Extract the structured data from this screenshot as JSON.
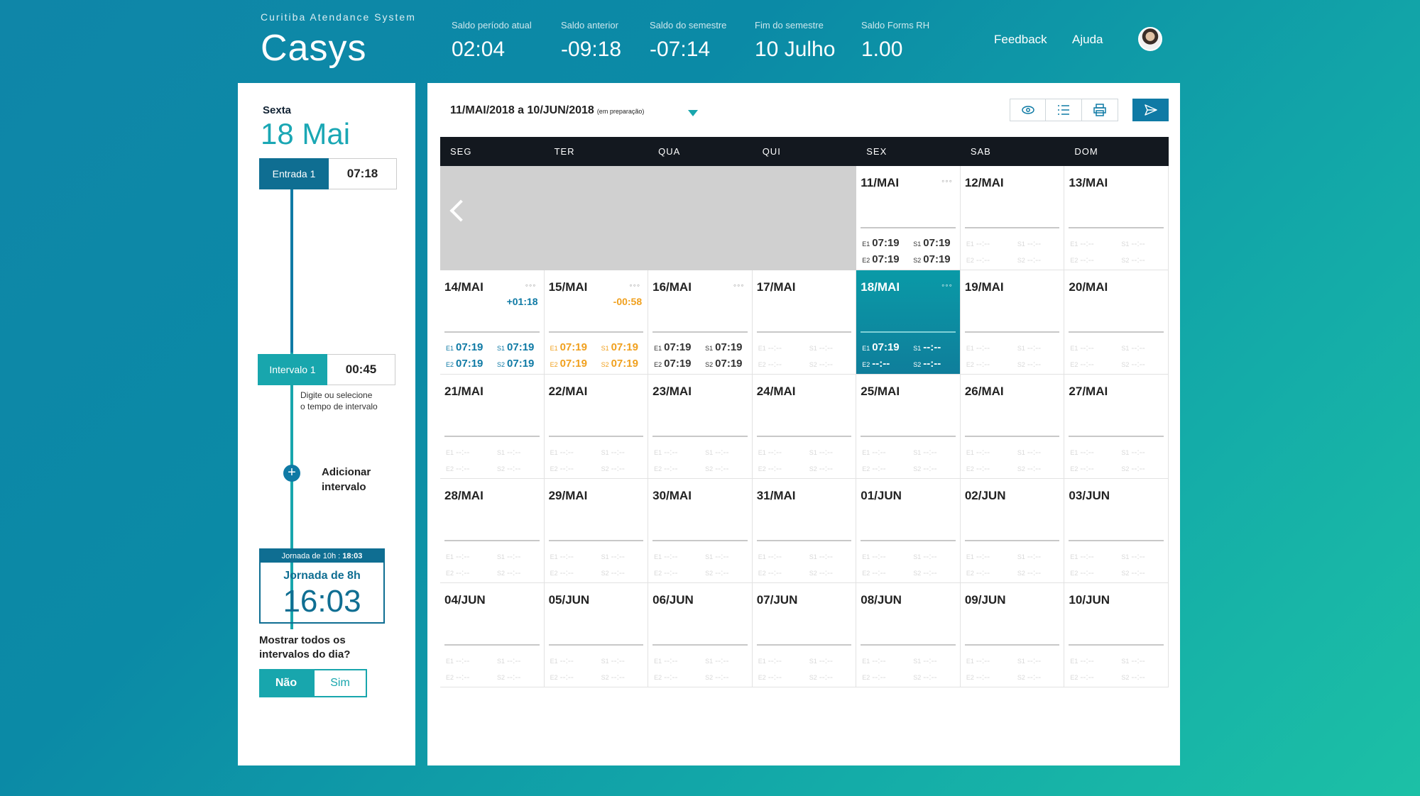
{
  "brand": {
    "subtitle": "Curitiba Atendance System",
    "name": "Casys"
  },
  "stats": [
    {
      "label": "Saldo período atual",
      "value": "02:04"
    },
    {
      "label": "Saldo anterior",
      "value": "-09:18"
    },
    {
      "label": "Saldo do semestre",
      "value": "-07:14"
    },
    {
      "label": "Fim do semestre",
      "value": "10 Julho"
    },
    {
      "label": "Saldo Forms RH",
      "value": "1.00"
    }
  ],
  "nav": {
    "feedback": "Feedback",
    "help": "Ajuda"
  },
  "left": {
    "day_name": "Sexta",
    "day_date": "18 Mai",
    "entry": {
      "tag": "Entrada 1",
      "time": "07:18"
    },
    "interval": {
      "tag": "Intervalo 1",
      "time": "00:45"
    },
    "hint_line1": "Digite ou selecione",
    "hint_line2": "o tempo de intervalo",
    "add_line1": "Adicionar",
    "add_line2": "intervalo",
    "jornada_bar_label": "Jornada de 10h :",
    "jornada_bar_time": "18:03",
    "jornada_title": "Jornada de 8h",
    "jornada_time": "16:03",
    "question_line1": "Mostrar todos os",
    "question_line2": "intervalos do dia?",
    "toggle_no": "Não",
    "toggle_yes": "Sim"
  },
  "main": {
    "range": "11/MAI/2018 a 10/JUN/2018",
    "range_status": "(em preparação)",
    "weekdays": [
      "SEG",
      "TER",
      "QUA",
      "QUI",
      "SEX",
      "SAB",
      "DOM"
    ],
    "empty_time": "--:--",
    "days": [
      {
        "label": "11/MAI",
        "col": 4,
        "row": 0,
        "dots": true,
        "e1": "07:19",
        "s1": "07:19",
        "e2": "07:19",
        "s2": "07:19"
      },
      {
        "label": "12/MAI",
        "col": 5,
        "row": 0
      },
      {
        "label": "13/MAI",
        "col": 6,
        "row": 0
      },
      {
        "label": "14/MAI",
        "col": 0,
        "row": 1,
        "dots": true,
        "balance": "+01:18",
        "balance_color": "blue",
        "e1": "07:19",
        "s1": "07:19",
        "e2": "07:19",
        "s2": "07:19",
        "time_color": "blue"
      },
      {
        "label": "15/MAI",
        "col": 1,
        "row": 1,
        "dots": true,
        "balance": "-00:58",
        "balance_color": "orange",
        "e1": "07:19",
        "s1": "07:19",
        "e2": "07:19",
        "s2": "07:19",
        "time_color": "orange"
      },
      {
        "label": "16/MAI",
        "col": 2,
        "row": 1,
        "dots": true,
        "e1": "07:19",
        "s1": "07:19",
        "e2": "07:19",
        "s2": "07:19"
      },
      {
        "label": "17/MAI",
        "col": 3,
        "row": 1
      },
      {
        "label": "18/MAI",
        "col": 4,
        "row": 1,
        "dots": true,
        "selected": true,
        "e1": "07:19",
        "s1": "--:--",
        "e2": "--:--",
        "s2": "--:--"
      },
      {
        "label": "19/MAI",
        "col": 5,
        "row": 1
      },
      {
        "label": "20/MAI",
        "col": 6,
        "row": 1
      },
      {
        "label": "21/MAI",
        "col": 0,
        "row": 2
      },
      {
        "label": "22/MAI",
        "col": 1,
        "row": 2
      },
      {
        "label": "23/MAI",
        "col": 2,
        "row": 2
      },
      {
        "label": "24/MAI",
        "col": 3,
        "row": 2
      },
      {
        "label": "25/MAI",
        "col": 4,
        "row": 2
      },
      {
        "label": "26/MAI",
        "col": 5,
        "row": 2
      },
      {
        "label": "27/MAI",
        "col": 6,
        "row": 2
      },
      {
        "label": "28/MAI",
        "col": 0,
        "row": 3
      },
      {
        "label": "29/MAI",
        "col": 1,
        "row": 3
      },
      {
        "label": "30/MAI",
        "col": 2,
        "row": 3
      },
      {
        "label": "31/MAI",
        "col": 3,
        "row": 3
      },
      {
        "label": "01/JUN",
        "col": 4,
        "row": 3
      },
      {
        "label": "02/JUN",
        "col": 5,
        "row": 3
      },
      {
        "label": "03/JUN",
        "col": 6,
        "row": 3
      },
      {
        "label": "04/JUN",
        "col": 0,
        "row": 4
      },
      {
        "label": "05/JUN",
        "col": 1,
        "row": 4
      },
      {
        "label": "06/JUN",
        "col": 2,
        "row": 4
      },
      {
        "label": "07/JUN",
        "col": 3,
        "row": 4
      },
      {
        "label": "08/JUN",
        "col": 4,
        "row": 4
      },
      {
        "label": "09/JUN",
        "col": 5,
        "row": 4
      },
      {
        "label": "10/JUN",
        "col": 6,
        "row": 4
      }
    ]
  },
  "colors": {
    "accent": "#18a6ad",
    "primary": "#0f7aa5",
    "positive": "#0f7aa5",
    "negative": "#f0a01e"
  }
}
